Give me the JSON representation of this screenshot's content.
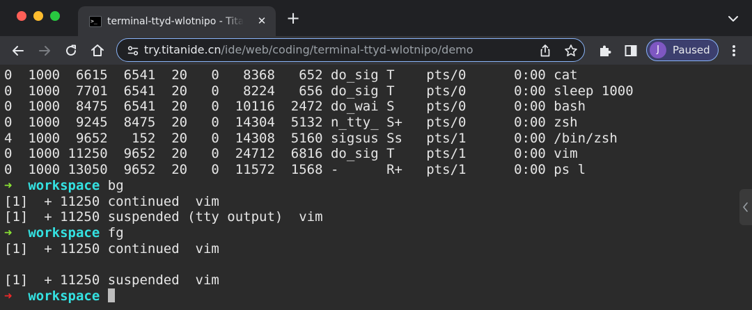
{
  "window": {
    "controls": [
      "close",
      "minimize",
      "maximize"
    ],
    "tab": {
      "favicon_text": ">_",
      "title": "terminal-ttyd-wlotnipo - TitanIDE",
      "close_glyph": "✕"
    },
    "new_tab_glyph": "+"
  },
  "toolbar": {
    "url_host": "try.titanide.cn",
    "url_path": "/ide/web/coding/terminal-ttyd-wlotnipo/demo",
    "profile": {
      "initial": "J",
      "label": "Paused"
    }
  },
  "terminal": {
    "ps_rows": [
      "0  1000  6615  6541  20   0   8368   652 do_sig T    pts/0      0:00 cat",
      "0  1000  7701  6541  20   0   8224   656 do_sig T    pts/0      0:00 sleep 1000",
      "0  1000  8475  6541  20   0  10116  2472 do_wai S    pts/0      0:00 bash",
      "0  1000  9245  8475  20   0  14304  5132 n_tty_ S+   pts/0      0:00 zsh",
      "4  1000  9652   152  20   0  14308  5160 sigsus Ss   pts/1      0:00 /bin/zsh",
      "0  1000 11250  9652  20   0  24712  6816 do_sig T    pts/1      0:00 vim",
      "0  1000 13050  9652  20   0  11572  1568 -      R+   pts/1      0:00 ps l"
    ],
    "prompt_arrow": "➜",
    "prompt_dir": "workspace",
    "cmd_bg": "bg",
    "out_bg_1": "[1]  + 11250 continued  vim",
    "out_bg_2": "[1]  + 11250 suspended (tty output)  vim",
    "cmd_fg": "fg",
    "out_fg_1": "[1]  + 11250 continued  vim",
    "out_fg_blank": "",
    "out_fg_2": "[1]  + 11250 suspended  vim"
  },
  "colors": {
    "prompt_ok": "#8ae234",
    "prompt_err": "#ef2929",
    "prompt_dir": "#34e2e2",
    "accent": "#8ab4f8"
  }
}
